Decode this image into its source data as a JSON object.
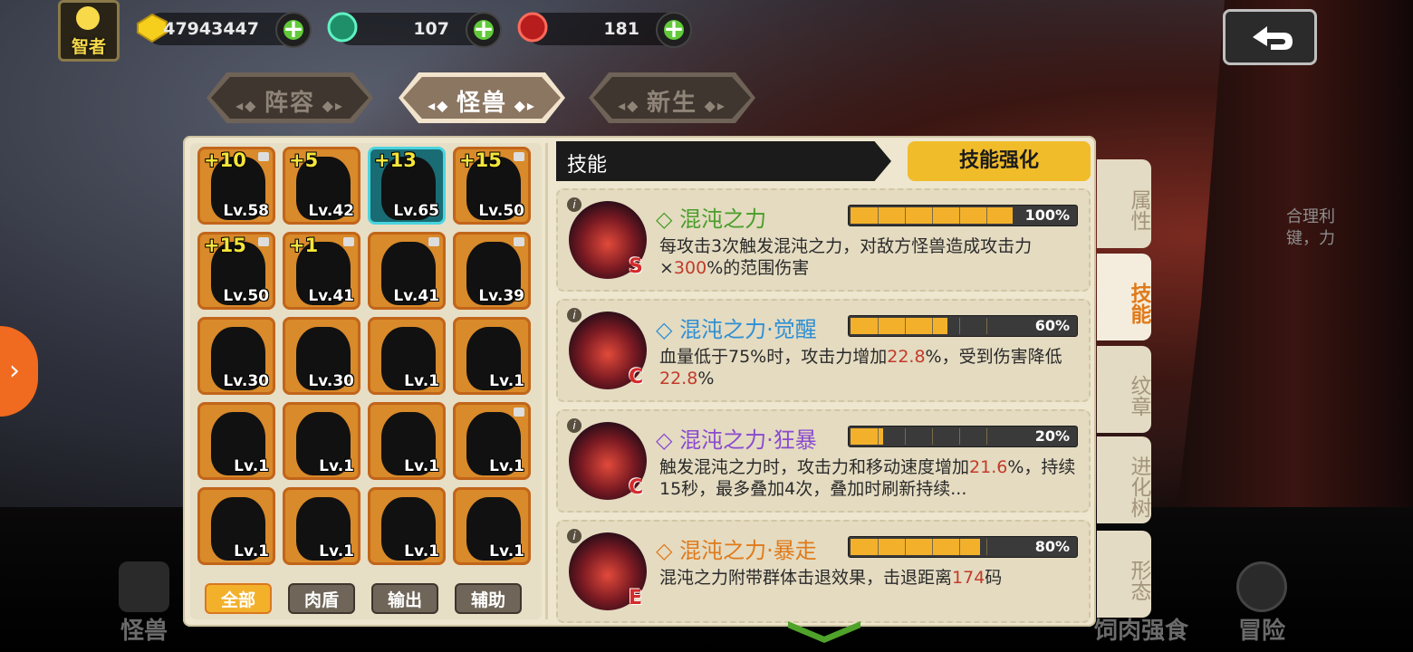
{
  "header": {
    "rank_label": "智者",
    "gold": "47943447",
    "green_gem": "107",
    "red_gem": "181"
  },
  "top_tabs": [
    {
      "label": "阵容",
      "active": false
    },
    {
      "label": "怪兽",
      "active": true
    },
    {
      "label": "新生",
      "active": false
    }
  ],
  "monsters": [
    {
      "plus": "+10",
      "level": "Lv.58",
      "locked": true,
      "selected": false
    },
    {
      "plus": "+5",
      "level": "Lv.42",
      "locked": false,
      "selected": false
    },
    {
      "plus": "+13",
      "level": "Lv.65",
      "locked": false,
      "selected": true
    },
    {
      "plus": "+15",
      "level": "Lv.50",
      "locked": true,
      "selected": false
    },
    {
      "plus": "+15",
      "level": "Lv.50",
      "locked": true,
      "selected": false
    },
    {
      "plus": "+1",
      "level": "Lv.41",
      "locked": true,
      "selected": false
    },
    {
      "plus": "",
      "level": "Lv.41",
      "locked": true,
      "selected": false
    },
    {
      "plus": "",
      "level": "Lv.39",
      "locked": true,
      "selected": false
    },
    {
      "plus": "",
      "level": "Lv.30",
      "locked": false,
      "selected": false
    },
    {
      "plus": "",
      "level": "Lv.30",
      "locked": false,
      "selected": false
    },
    {
      "plus": "",
      "level": "Lv.1",
      "locked": false,
      "selected": false
    },
    {
      "plus": "",
      "level": "Lv.1",
      "locked": false,
      "selected": false
    },
    {
      "plus": "",
      "level": "Lv.1",
      "locked": false,
      "selected": false
    },
    {
      "plus": "",
      "level": "Lv.1",
      "locked": false,
      "selected": false
    },
    {
      "plus": "",
      "level": "Lv.1",
      "locked": false,
      "selected": false
    },
    {
      "plus": "",
      "level": "Lv.1",
      "locked": true,
      "selected": false
    },
    {
      "plus": "",
      "level": "Lv.1",
      "locked": false,
      "selected": false
    },
    {
      "plus": "",
      "level": "Lv.1",
      "locked": false,
      "selected": false
    },
    {
      "plus": "",
      "level": "Lv.1",
      "locked": false,
      "selected": false
    },
    {
      "plus": "",
      "level": "Lv.1",
      "locked": false,
      "selected": false
    }
  ],
  "filters": [
    {
      "label": "全部",
      "active": true
    },
    {
      "label": "肉盾",
      "active": false
    },
    {
      "label": "输出",
      "active": false
    },
    {
      "label": "辅助",
      "active": false
    }
  ],
  "skills_header": "技能",
  "enhance_button": "技能强化",
  "skills": [
    {
      "name": "混沌之力",
      "grade": "S",
      "name_color": "#4a9e2a",
      "progress": 100,
      "progress_label": "100%",
      "desc_parts": [
        "每攻击3次触发混沌之力，对敌方怪兽造成攻击力×",
        "300",
        "%的范围伤害"
      ]
    },
    {
      "name": "混沌之力·觉醒",
      "grade": "C",
      "name_color": "#2f8fd4",
      "progress": 60,
      "progress_label": "60%",
      "desc_parts": [
        "血量低于75%时，攻击力增加",
        "22.8",
        "%，受到伤害降低",
        "22.8",
        "%"
      ]
    },
    {
      "name": "混沌之力·狂暴",
      "grade": "C",
      "name_color": "#8a4ad0",
      "progress": 20,
      "progress_label": "20%",
      "desc_parts": [
        "触发混沌之力时，攻击力和移动速度增加",
        "21.6",
        "%，持续15秒，最多叠加4次，叠加时刷新持续..."
      ]
    },
    {
      "name": "混沌之力·暴走",
      "grade": "E",
      "name_color": "#e07a1a",
      "progress": 80,
      "progress_label": "80%",
      "desc_parts": [
        "混沌之力附带群体击退效果，击退距离",
        "174",
        "码"
      ]
    }
  ],
  "side_tabs": [
    {
      "label": "属性",
      "active": false
    },
    {
      "label": "技能",
      "active": true
    },
    {
      "label": "纹章",
      "active": false
    },
    {
      "label": "进化树",
      "active": false
    },
    {
      "label": "形态",
      "active": false
    }
  ],
  "bottom_nav": [
    {
      "label": "怪兽"
    },
    {
      "label": "饲肉强食"
    },
    {
      "label": "冒险"
    }
  ],
  "side_note": [
    "合理利",
    "键，力"
  ]
}
